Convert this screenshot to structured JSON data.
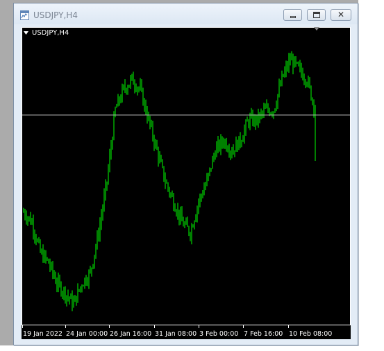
{
  "window": {
    "title": "USDJPY,H4",
    "icon": "chart-window-icon",
    "buttons": {
      "minimize": "minimize-icon",
      "maximize": "maximize-icon",
      "close": "close-icon"
    }
  },
  "colors": {
    "chart_background": "#000000",
    "candle": "#00ff00",
    "grid_and_text": "#ffffff",
    "price_line": "#c0c0c0"
  },
  "chart_data": {
    "type": "candlestick",
    "symbol_label": "USDJPY,H4",
    "x_tick_labels": [
      "19 Jan 2022",
      "24 Jan 00:00",
      "26 Jan 16:00",
      "31 Jan 08:00",
      "3 Feb 00:00",
      "7 Feb 16:00",
      "10 Feb 08:00"
    ],
    "y_range_estimate": [
      113.5,
      116.4
    ],
    "close_path_estimate": [
      114.6,
      114.5,
      114.2,
      114.1,
      113.9,
      113.8,
      113.7,
      113.9,
      114.0,
      114.4,
      114.9,
      115.6,
      115.8,
      115.9,
      115.8,
      115.5,
      115.2,
      114.9,
      114.7,
      114.5,
      114.4,
      114.7,
      114.9,
      115.2,
      115.3,
      115.2,
      115.3,
      115.5,
      115.5,
      115.6,
      115.6,
      115.9,
      116.1,
      116.0,
      115.9,
      115.6
    ],
    "current_price_line_estimate": 115.55
  }
}
